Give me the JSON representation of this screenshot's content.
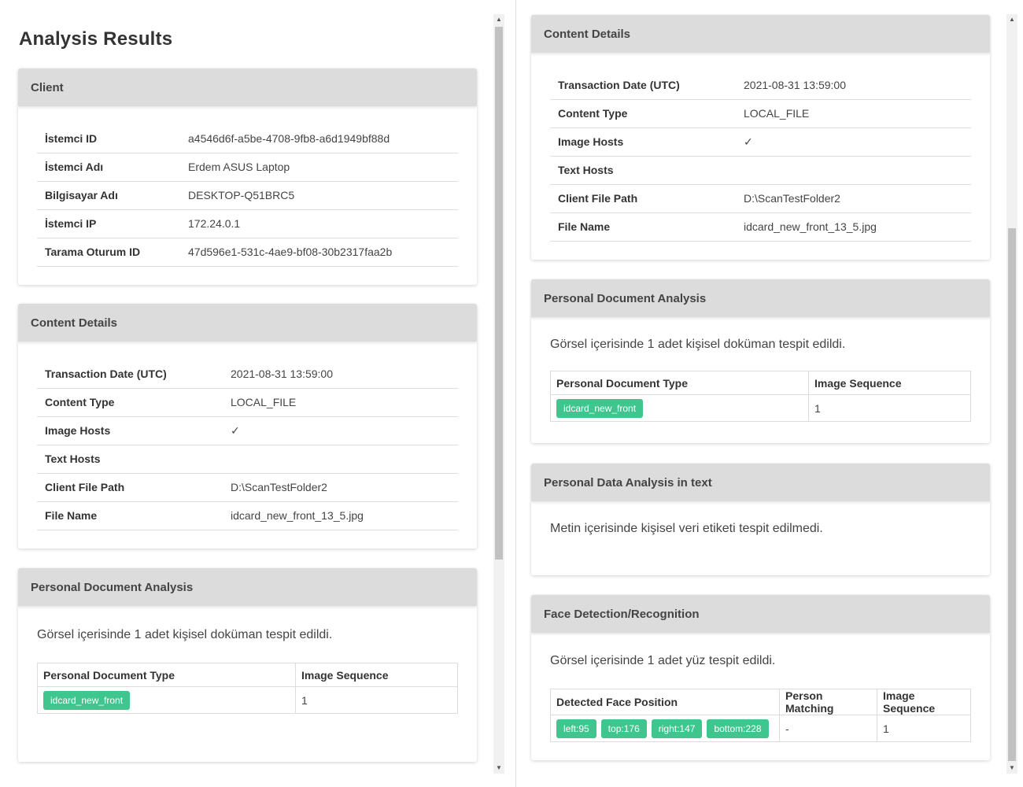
{
  "left": {
    "title": "Analysis Results",
    "client": {
      "header": "Client",
      "rows": [
        {
          "key": "İstemci ID",
          "value": "a4546d6f-a5be-4708-9fb8-a6d1949bf88d"
        },
        {
          "key": "İstemci Adı",
          "value": "Erdem ASUS Laptop"
        },
        {
          "key": "Bilgisayar Adı",
          "value": "DESKTOP-Q51BRC5"
        },
        {
          "key": "İstemci IP",
          "value": "172.24.0.1"
        },
        {
          "key": "Tarama Oturum ID",
          "value": "47d596e1-531c-4ae9-bf08-30b2317faa2b"
        }
      ]
    },
    "content": {
      "header": "Content Details",
      "rows": [
        {
          "key": "Transaction Date (UTC)",
          "value": "2021-08-31 13:59:00"
        },
        {
          "key": "Content Type",
          "value": "LOCAL_FILE"
        },
        {
          "key": "Image Hosts",
          "value": "✓"
        },
        {
          "key": "Text Hosts",
          "value": ""
        },
        {
          "key": "Client File Path",
          "value": "D:\\ScanTestFolder2"
        },
        {
          "key": "File Name",
          "value": "idcard_new_front_13_5.jpg"
        }
      ]
    },
    "personal_doc": {
      "header": "Personal Document Analysis",
      "description": "Görsel içerisinde 1 adet kişisel doküman tespit edildi.",
      "columns": [
        "Personal Document Type",
        "Image Sequence"
      ],
      "row": {
        "badge": "idcard_new_front",
        "sequence": "1"
      }
    }
  },
  "right": {
    "content": {
      "header": "Content Details",
      "rows": [
        {
          "key": "Transaction Date (UTC)",
          "value": "2021-08-31 13:59:00"
        },
        {
          "key": "Content Type",
          "value": "LOCAL_FILE"
        },
        {
          "key": "Image Hosts",
          "value": "✓"
        },
        {
          "key": "Text Hosts",
          "value": ""
        },
        {
          "key": "Client File Path",
          "value": "D:\\ScanTestFolder2"
        },
        {
          "key": "File Name",
          "value": "idcard_new_front_13_5.jpg"
        }
      ]
    },
    "personal_doc": {
      "header": "Personal Document Analysis",
      "description": "Görsel içerisinde 1 adet kişisel doküman tespit edildi.",
      "columns": [
        "Personal Document Type",
        "Image Sequence"
      ],
      "row": {
        "badge": "idcard_new_front",
        "sequence": "1"
      }
    },
    "personal_data_text": {
      "header": "Personal Data Analysis in text",
      "description": "Metin içerisinde kişisel veri etiketi tespit edilmedi."
    },
    "face": {
      "header": "Face Detection/Recognition",
      "description": "Görsel içerisinde 1 adet yüz tespit edildi.",
      "columns": [
        "Detected Face Position",
        "Person Matching",
        "Image Sequence"
      ],
      "row": {
        "badges": [
          "left:95",
          "top:176",
          "right:147",
          "bottom:228"
        ],
        "matching": "-",
        "sequence": "1"
      }
    }
  },
  "colors": {
    "badge": "#3ec68e",
    "card_header_bg": "#dcdcdc",
    "scroll_thumb": "#c1c1c1"
  }
}
